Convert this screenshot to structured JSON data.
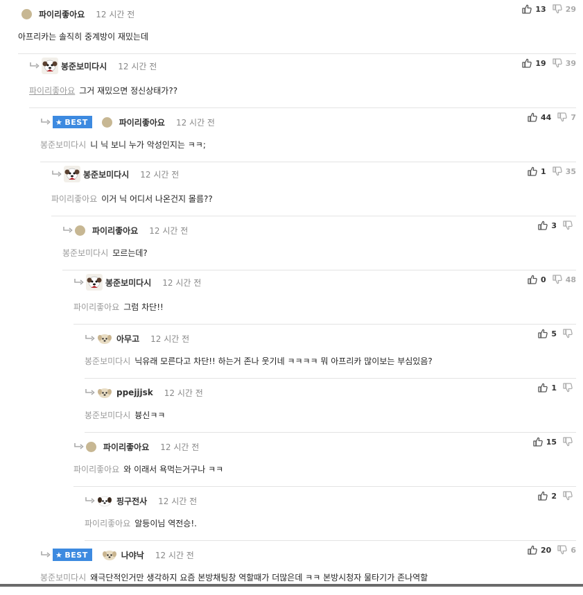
{
  "comments": [
    {
      "author": "파이리좋아요",
      "time": "12 시간 전",
      "up": "13",
      "down": "29",
      "mention": "",
      "text": "아프리카는 솔직히 중계방이 재밌는데"
    },
    {
      "author": "봉준보미다시",
      "time": "12 시간 전",
      "up": "19",
      "down": "39",
      "mention": "파이리좋아요",
      "text": "그거 재밌으면 정신상태가??"
    },
    {
      "author": "파이리좋아요",
      "time": "12 시간 전",
      "up": "44",
      "down": "7",
      "mention": "봉준보미다시",
      "text": "니 닉 보니 누가 악성인지는 ㅋㅋ;",
      "best": "BEST"
    },
    {
      "author": "봉준보미다시",
      "time": "12 시간 전",
      "up": "1",
      "down": "35",
      "mention": "파이리좋아요",
      "text": "이거 닉 어디서 나온건지 몰름??"
    },
    {
      "author": "파이리좋아요",
      "time": "12 시간 전",
      "up": "3",
      "down": "",
      "mention": "봉준보미다시",
      "text": "모르는데?"
    },
    {
      "author": "봉준보미다시",
      "time": "12 시간 전",
      "up": "0",
      "down": "48",
      "mention": "파이리좋아요",
      "text": "그럼 차단!!"
    },
    {
      "author": "아무고",
      "time": "12 시간 전",
      "up": "5",
      "down": "",
      "mention": "봉준보미다시",
      "text": "닉유래 모른다고 차단!! 하는거 존나 웃기네 ㅋㅋㅋㅋ 뭐 아프리카 많이보는 부심있음?"
    },
    {
      "author": "ppejjjsk",
      "time": "12 시간 전",
      "up": "1",
      "down": "",
      "mention": "봉준보미다시",
      "text": "븅신ㅋㅋ"
    },
    {
      "author": "파이리좋아요",
      "time": "12 시간 전",
      "up": "15",
      "down": "",
      "mention": "파이리좋아요",
      "text": "와 이래서 욕먹는거구나 ㅋㅋ"
    },
    {
      "author": "핑구전사",
      "time": "12 시간 전",
      "up": "2",
      "down": "",
      "mention": "파이리좋아요",
      "text": "알등이님 역전승!."
    },
    {
      "author": "나야낙",
      "time": "12 시간 전",
      "up": "20",
      "down": "6",
      "mention": "봉준보미다시",
      "text": "왜극단적인거만 생각하지 요즘 본방채팅창 역할때가 더많은데 ㅋㅋ 본방시청자 물타기가 존나역할",
      "best": "BEST"
    }
  ],
  "icons": {
    "up": "thumbs-up-icon",
    "down": "thumbs-down-icon",
    "reply": "reply-arrow-icon",
    "star": "star-icon"
  },
  "colors": {
    "best_badge": "#3d8ae0",
    "mention": "#999999",
    "divider": "#e3e3e3"
  }
}
